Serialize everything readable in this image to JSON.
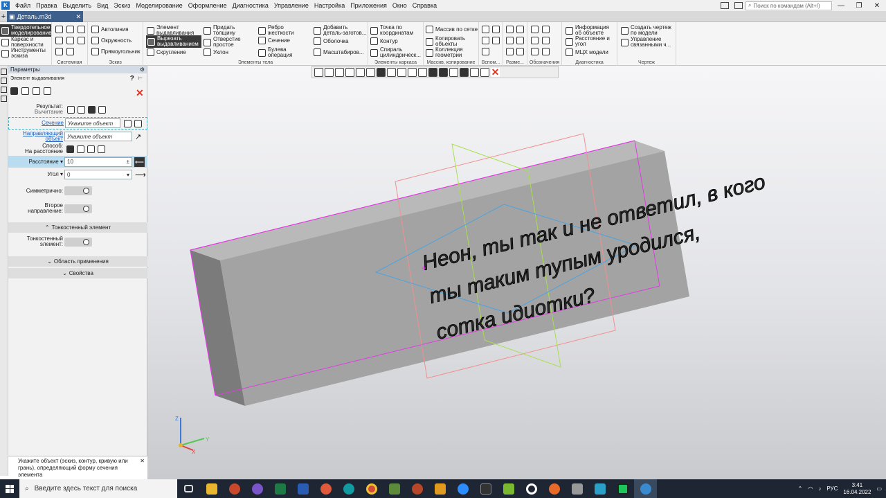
{
  "app": {
    "window_title": "",
    "search_placeholder": "Поиск по командам (Alt+/)",
    "doc_tab": "Деталь.m3d"
  },
  "menu": [
    "Файл",
    "Правка",
    "Выделить",
    "Вид",
    "Эскиз",
    "Моделирование",
    "Оформление",
    "Диагностика",
    "Управление",
    "Настройка",
    "Приложения",
    "Окно",
    "Справка"
  ],
  "ribbon": {
    "left": {
      "solid": "Твердотельное моделирование",
      "frame": "Каркас и поверхности",
      "tools": "Инструменты эскиза"
    },
    "groups": {
      "system": "Системная",
      "sketch": "Эскиз",
      "body": "Элементы тела",
      "frame": "Элементы каркаса",
      "array": "Массив, копирование",
      "aux": "Вспом...",
      "dim": "Разме...",
      "notes": "Обозначения",
      "diag": "Диагностика",
      "draw": "Чертеж"
    },
    "sketch": {
      "autoline": "Автолиния",
      "circle": "Окружность",
      "rect": "Прямоугольник"
    },
    "body": {
      "extrude": "Элемент выдавливания",
      "cut": "Вырезать выдавливанием",
      "fillet": "Скругление",
      "thicken": "Придать толщину",
      "hole": "Отверстие простое",
      "slope": "Уклон",
      "rib": "Ребро жесткости",
      "section": "Сечение",
      "bool": "Булева операция",
      "addpart": "Добавить деталь-заготов...",
      "shell": "Оболочка",
      "scale": "Масштабиров..."
    },
    "frame": {
      "point": "Точка по координатам",
      "contour": "Контур",
      "spiral": "Спираль цилиндрическ..."
    },
    "array": {
      "grid": "Массив по сетке",
      "copy": "Копировать объекты",
      "collect": "Коллекция геометрии"
    },
    "diag": {
      "info": "Информация об объекте",
      "dist": "Расстояние и угол",
      "mcx": "МЦХ модели"
    },
    "draw": {
      "create": "Создать чертеж по модели",
      "manage": "Управление связанными ч..."
    }
  },
  "panel": {
    "title": "Параметры",
    "element": "Элемент выдавливания",
    "result_label": "Результат:",
    "result_value": "Вычитание",
    "section_label": "Сечение",
    "section_placeholder": "Укажите объект",
    "direction_label": "Направляющий объект",
    "direction_placeholder": "Укажите объект",
    "method_label": "Способ:",
    "method_value": "На расстояние",
    "distance_label": "Расстояние",
    "distance_value": "10",
    "angle_label": "Угол",
    "angle_value": "0",
    "symmetric_label": "Симметрично:",
    "second_label": "Второе направление:",
    "thin_section": "Тонкостенный элемент",
    "thin_label": "Тонкостенный элемент:",
    "scope_section": "Область применения",
    "props_section": "Свойства",
    "hint": "Укажите объект (эскиз, контур, кривую или грань), определяющий форму сечения элемента"
  },
  "model": {
    "lines": [
      "Неон, ты так и не ответил, в кого",
      "ты таким тупым уродился,",
      "сотка идиотки?"
    ]
  },
  "axes": {
    "x": "X",
    "y": "Y",
    "z": "Z"
  },
  "taskbar": {
    "search": "Введите здесь текст для поиска",
    "lang": "РУС",
    "time": "3:41",
    "date": "16.04.2022"
  },
  "colors": {
    "accent": "#3d5f8c",
    "active_row": "#b9dcf0",
    "magenta": "#e13be1",
    "green": "#a8e04a",
    "red": "#f09090",
    "blue": "#4aa3e0"
  }
}
